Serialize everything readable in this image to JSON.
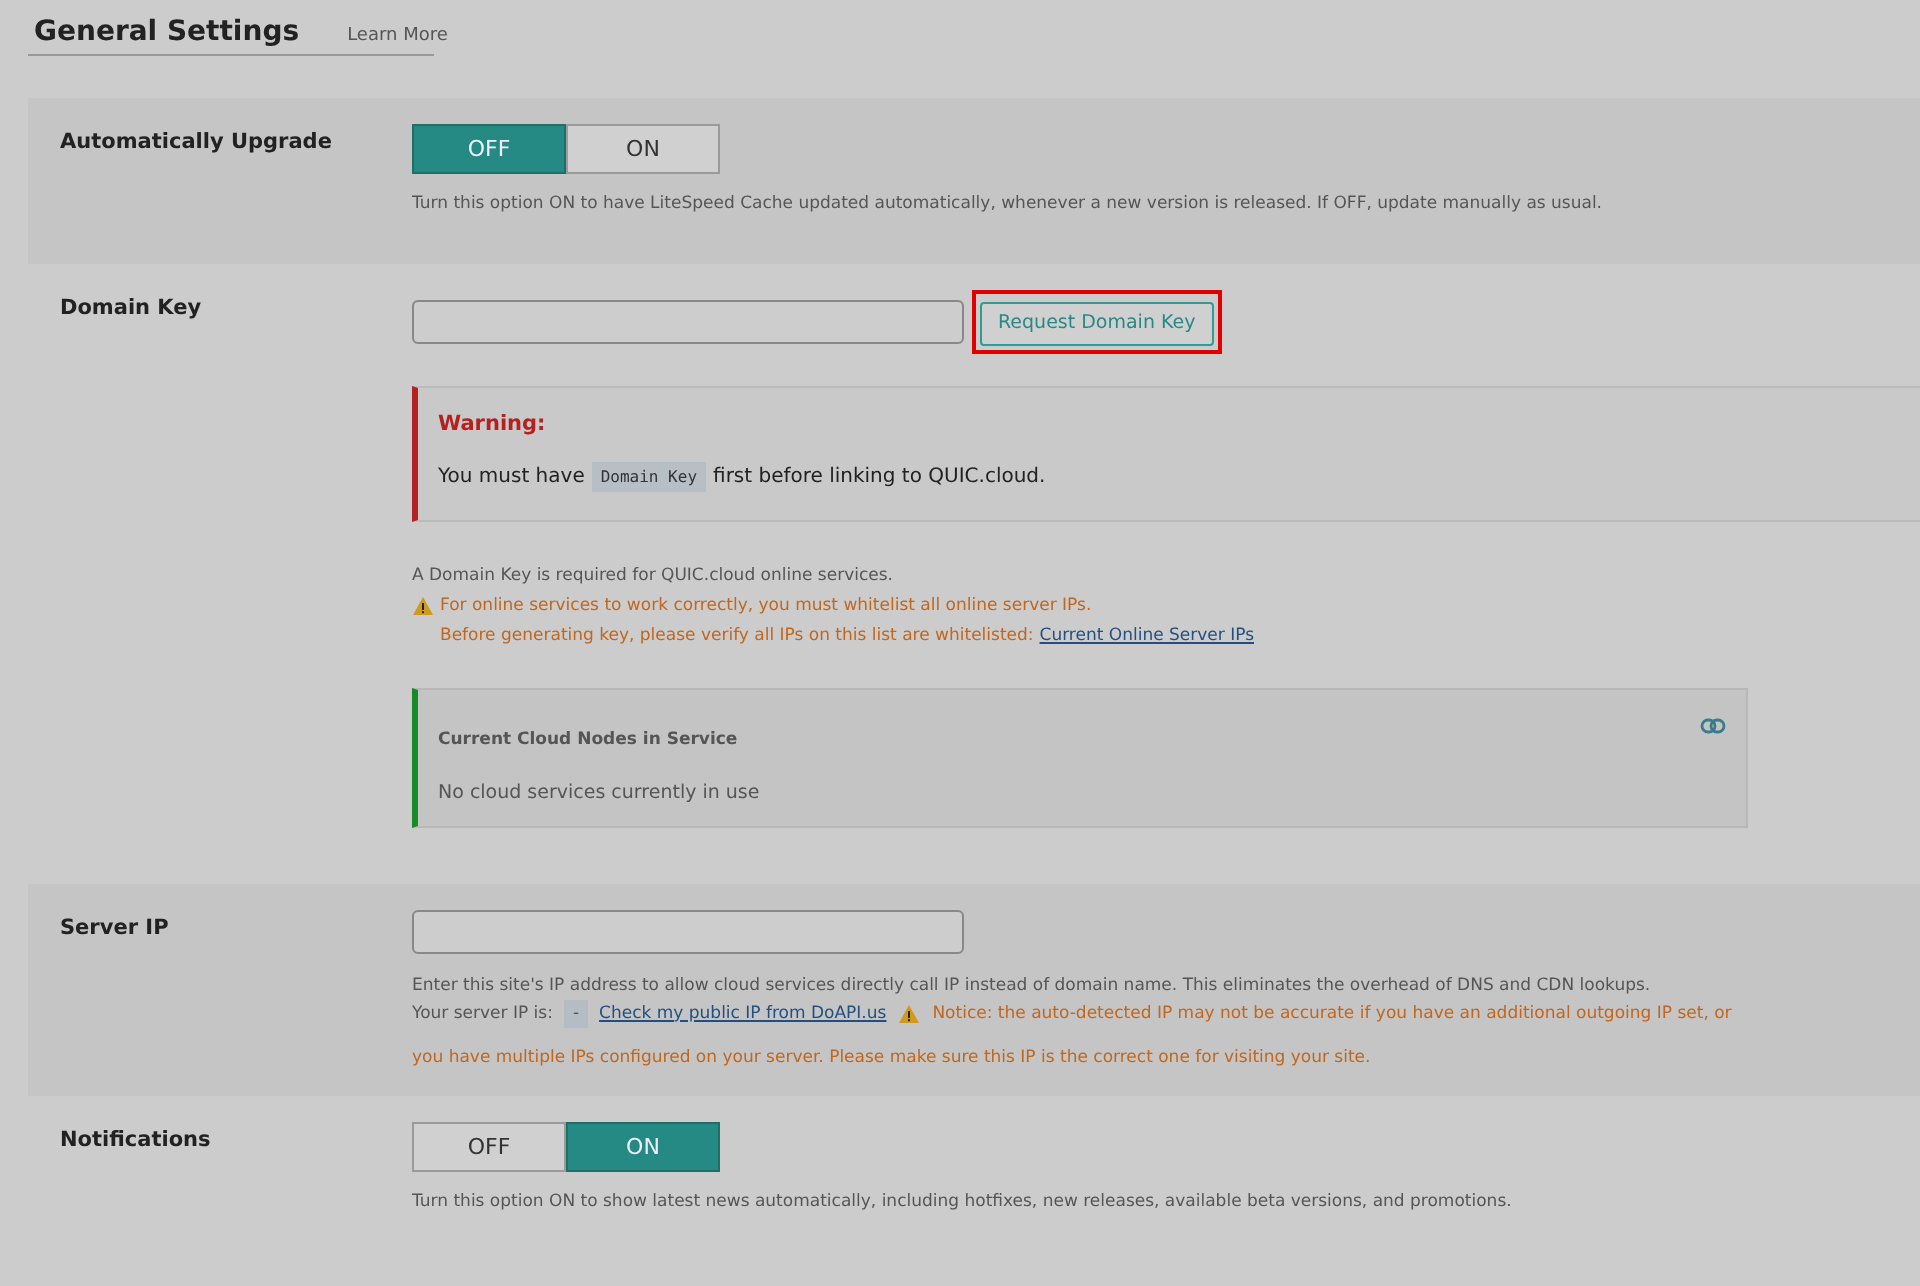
{
  "header": {
    "title": "General Settings",
    "link": "Learn More"
  },
  "settings": [
    {
      "kind": "toggle",
      "label": "Automatically Upgrade",
      "options": [
        {
          "label": "OFF",
          "selected": true
        },
        {
          "label": "ON",
          "selected": false
        }
      ],
      "description": "Turn this option ON to have LiteSpeed Cache updated automatically, whenever a new version is released. If OFF, update manually as usual."
    },
    {
      "kind": "domain_key",
      "label": "Domain Key",
      "button": "Request Domain Key",
      "button_highlighted": true,
      "warning": {
        "title": "Warning:",
        "before": "You must have",
        "code": "Domain Key",
        "after": "first before linking to QUIC.cloud."
      },
      "note": "A Domain Key is required for QUIC.cloud online services.",
      "alert": "For online services to work correctly, you must whitelist all online server IPs.",
      "alert_2": "Before generating key, please verify all IPs on this list are whitelisted:",
      "alert_link": "Current Online Server IPs",
      "panel": {
        "title": "Current Cloud Nodes in Service",
        "body": "No cloud services currently in use"
      }
    },
    {
      "kind": "server_ip",
      "label": "Server IP",
      "description": "Enter this site's IP address to allow cloud services directly call IP instead of domain name. This eliminates the overhead of DNS and CDN lookups.",
      "ip_label": "Your server IP is:",
      "ip_value": "-",
      "ip_link": "Check my public IP from DoAPI.us",
      "notice": "Notice: the auto-detected IP may not be accurate if you have an additional outgoing IP set, or",
      "notice_2": "you have multiple IPs configured on your server. Please make sure this IP is the correct one for visiting your site."
    },
    {
      "kind": "toggle",
      "label": "Notifications",
      "options": [
        {
          "label": "OFF",
          "selected": false
        },
        {
          "label": "ON",
          "selected": true
        }
      ],
      "description": "Turn this option ON to show latest news automatically, including hotfixes, new releases, available beta versions, and promotions."
    }
  ]
}
